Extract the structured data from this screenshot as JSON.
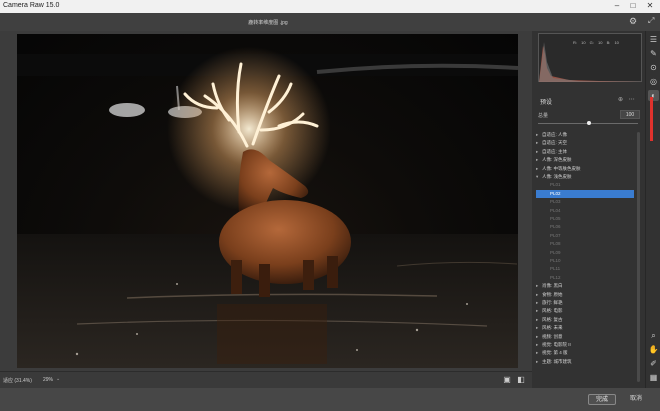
{
  "window": {
    "app_title": "Camera Raw 15.0",
    "file_title": "鹿转率维度图 .jpg",
    "controls": {
      "minimize": "–",
      "maximize": "□",
      "close": "✕"
    }
  },
  "topbar": {
    "settings_icon": "gear-icon",
    "fullscreen_icon": "expand-icon"
  },
  "histogram": {
    "readout": "R: 10   G: 10   B: 10"
  },
  "presets_panel": {
    "title": "预设",
    "header_icons": [
      "new-preset-icon",
      "more-icon"
    ],
    "amount_label": "总量",
    "amount_value": "100",
    "amount_level": 0.5,
    "groups_top": [
      {
        "label": "自适应: 人像"
      },
      {
        "label": "自适应: 天空"
      },
      {
        "label": "自适应: 主体"
      },
      {
        "label": "人像: 深色皮肤"
      },
      {
        "label": "人像: 中等肤色皮肤"
      },
      {
        "label": "人像: 浅色皮肤"
      }
    ],
    "items": [
      "PL01",
      "PL02",
      "PL03",
      "PL04",
      "PL05",
      "PL06",
      "PL07",
      "PL08",
      "PL09",
      "PL10",
      "PL11",
      "PL12"
    ],
    "selected_index": 1,
    "groups_bottom": [
      {
        "label": "肖像: 黑白"
      },
      {
        "label": "食物: 原始"
      },
      {
        "label": "旅行: 鲜艳"
      },
      {
        "label": "风格: 电影"
      },
      {
        "label": "风格: 复古"
      },
      {
        "label": "风格: 未来"
      },
      {
        "label": "视频: 创意"
      },
      {
        "label": "视觉: 电影院 II"
      },
      {
        "label": "视觉: 第 4 版"
      },
      {
        "label": "主题: 城市建筑"
      }
    ]
  },
  "toolstrip": [
    "edit-icon",
    "crop-icon",
    "heal-icon",
    "mask-icon",
    "redeye-icon",
    "presets-icon",
    "zoom-icon",
    "hand-icon",
    "eyedropper-icon",
    "grid-icon"
  ],
  "bottombar": {
    "zoom_fit": "适应 (31.4%)",
    "zoom_percent": "29%",
    "zoom_caret": "⌄"
  },
  "footer": {
    "done_label": "完成",
    "cancel_label": "取消"
  },
  "colors": {
    "accent": "#3a7cd0",
    "arrow": "#e0322d"
  }
}
